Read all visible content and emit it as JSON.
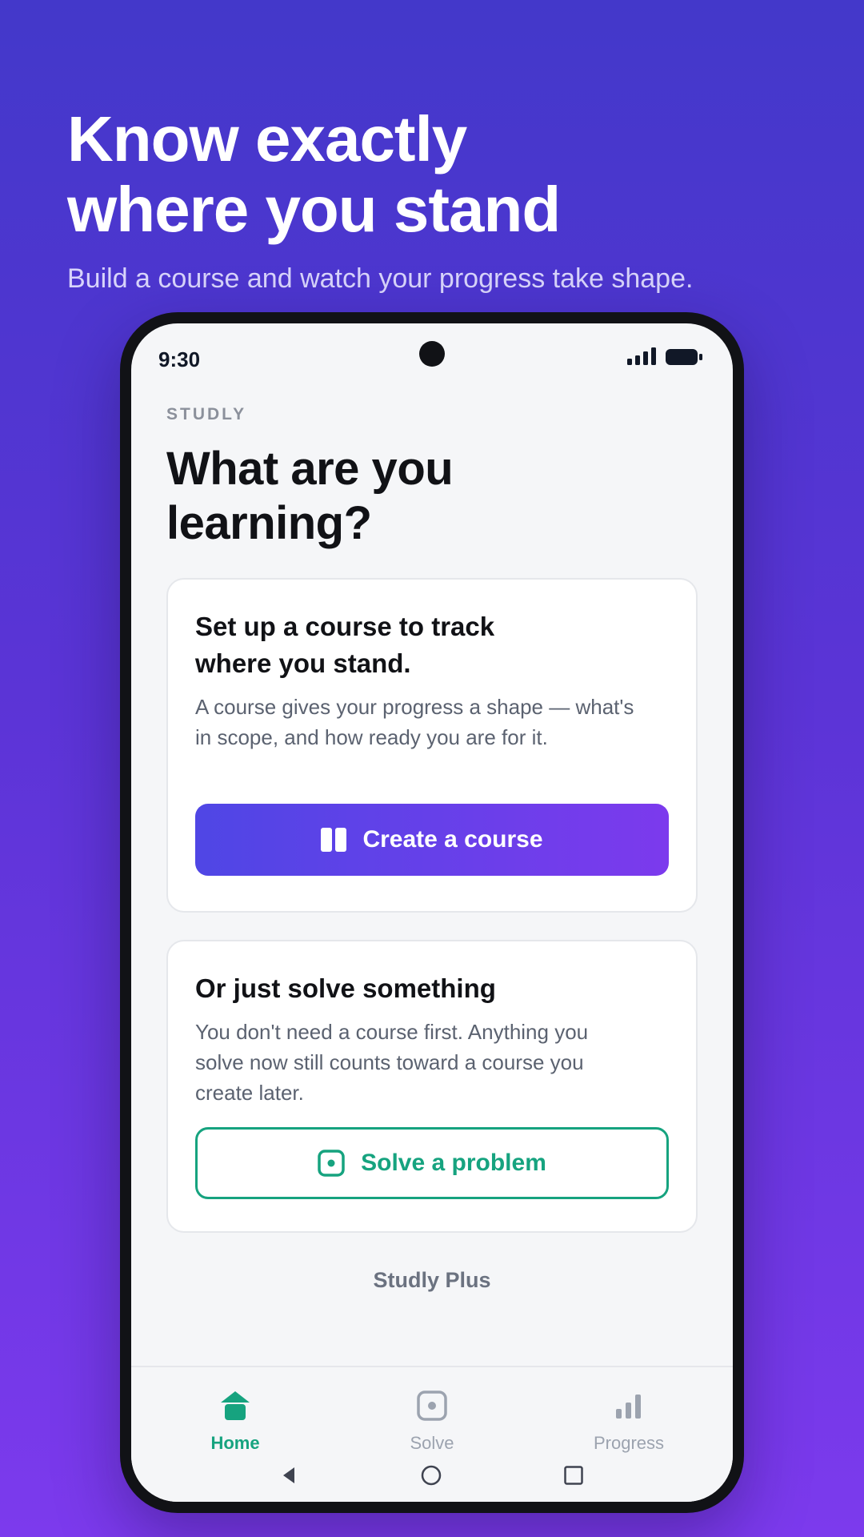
{
  "promo": {
    "title_line1": "Know exactly",
    "title_line2": "where you stand",
    "subtitle": "Build a course and watch your progress take shape."
  },
  "status_bar": {
    "time": "9:30",
    "icons": [
      "signal-icon",
      "battery-icon"
    ]
  },
  "screen": {
    "eyebrow": "STUDLY",
    "headline_line1": "What are you",
    "headline_line2": "learning?"
  },
  "course_card": {
    "title_line1": "Set up a course to track",
    "title_line2": "where you stand.",
    "body_line1": "A course gives your progress a shape — what's",
    "body_line2": "in scope, and how ready you are for it.",
    "button_label": "Create a course",
    "button_icon": "book-icon"
  },
  "solve_card": {
    "title": "Or just solve something",
    "body_line1": "You don't need a course first. Anything you",
    "body_line2": "solve now still counts toward a course you",
    "body_line3": "create later.",
    "button_label": "Solve a problem",
    "button_icon": "target-icon"
  },
  "plus_link": "Studly Plus",
  "bottom_nav": {
    "items": [
      {
        "label": "Home",
        "icon": "home-icon",
        "active": true
      },
      {
        "label": "Solve",
        "icon": "target-icon",
        "active": false
      },
      {
        "label": "Progress",
        "icon": "bar-chart-icon",
        "active": false
      }
    ]
  },
  "system_nav": [
    "back-icon",
    "home-circle-icon",
    "recents-icon"
  ],
  "colors": {
    "accent_green": "#16a37f",
    "primary_gradient_start": "#4f46e5",
    "primary_gradient_end": "#7c3aed",
    "background_gradient_start": "#4338ca",
    "background_gradient_end": "#7c3aed"
  }
}
